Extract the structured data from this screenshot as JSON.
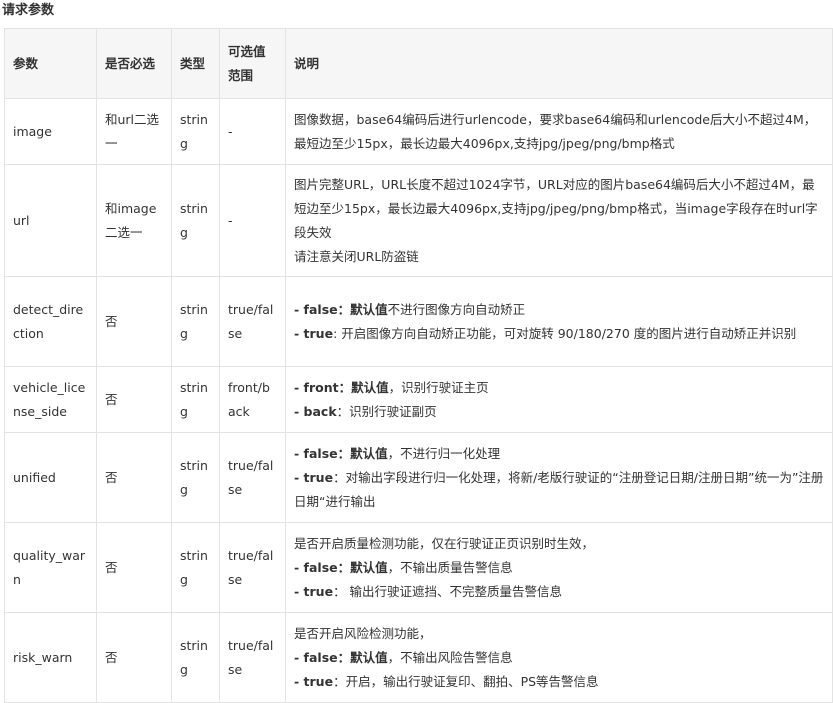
{
  "heading": "请求参数",
  "columns": [
    "参数",
    "是否必选",
    "类型",
    "可选值范围",
    "说明"
  ],
  "rows": [
    {
      "param": "image",
      "required": "和url二选一",
      "type": "string",
      "range": "-",
      "desc": [
        {
          "bold": "",
          "text": "图像数据，base64编码后进行urlencode，要求base64编码和urlencode后大小不超过4M，最短边至少15px，最长边最大4096px,支持jpg/jpeg/png/bmp格式"
        }
      ]
    },
    {
      "param": "url",
      "required": "和image二选一",
      "type": "string",
      "range": "-",
      "desc": [
        {
          "bold": "",
          "text": "图片完整URL，URL长度不超过1024字节，URL对应的图片base64编码后大小不超过4M，最短边至少15px，最长边最大4096px,支持jpg/jpeg/png/bmp格式，当image字段存在时url字段失效"
        },
        {
          "bold": "",
          "text": "请注意关闭URL防盗链"
        }
      ]
    },
    {
      "param": "detect_direction",
      "required": "否",
      "type": "string",
      "range": "true/false",
      "desc": [
        {
          "bold": "- false：默认值",
          "text": "不进行图像方向自动矫正"
        },
        {
          "bold": "- true",
          "text": ": 开启图像方向自动矫正功能，可对旋转 90/180/270 度的图片进行自动矫正并识别"
        }
      ]
    },
    {
      "param": "vehicle_license_side",
      "required": "否",
      "type": "string",
      "range": "front/back",
      "desc": [
        {
          "bold": "- front：默认值",
          "text": "，识别行驶证主页"
        },
        {
          "bold": "- back",
          "text": "：识别行驶证副页"
        }
      ]
    },
    {
      "param": "unified",
      "required": "否",
      "type": "string",
      "range": "true/false",
      "desc": [
        {
          "bold": "- false：默认值",
          "text": "，不进行归一化处理"
        },
        {
          "bold": "- true",
          "text": "：对输出字段进行归一化处理，将新/老版行驶证的“注册登记日期/注册日期”统一为”注册日期“进行输出"
        }
      ]
    },
    {
      "param": "quality_warn",
      "required": "否",
      "type": "string",
      "range": "true/false",
      "desc": [
        {
          "bold": "",
          "text": "是否开启质量检测功能，仅在行驶证正页识别时生效，"
        },
        {
          "bold": "- false：默认值",
          "text": "，不输出质量告警信息"
        },
        {
          "bold": "- true",
          "text": "： 输出行驶证遮挡、不完整质量告警信息"
        }
      ]
    },
    {
      "param": "risk_warn",
      "required": "否",
      "type": "string",
      "range": "true/false",
      "desc": [
        {
          "bold": "",
          "text": "是否开启风险检测功能，"
        },
        {
          "bold": "- false：默认值",
          "text": "，不输出风险告警信息"
        },
        {
          "bold": "- true",
          "text": "：开启，输出行驶证复印、翻拍、PS等告警信息"
        }
      ]
    }
  ]
}
